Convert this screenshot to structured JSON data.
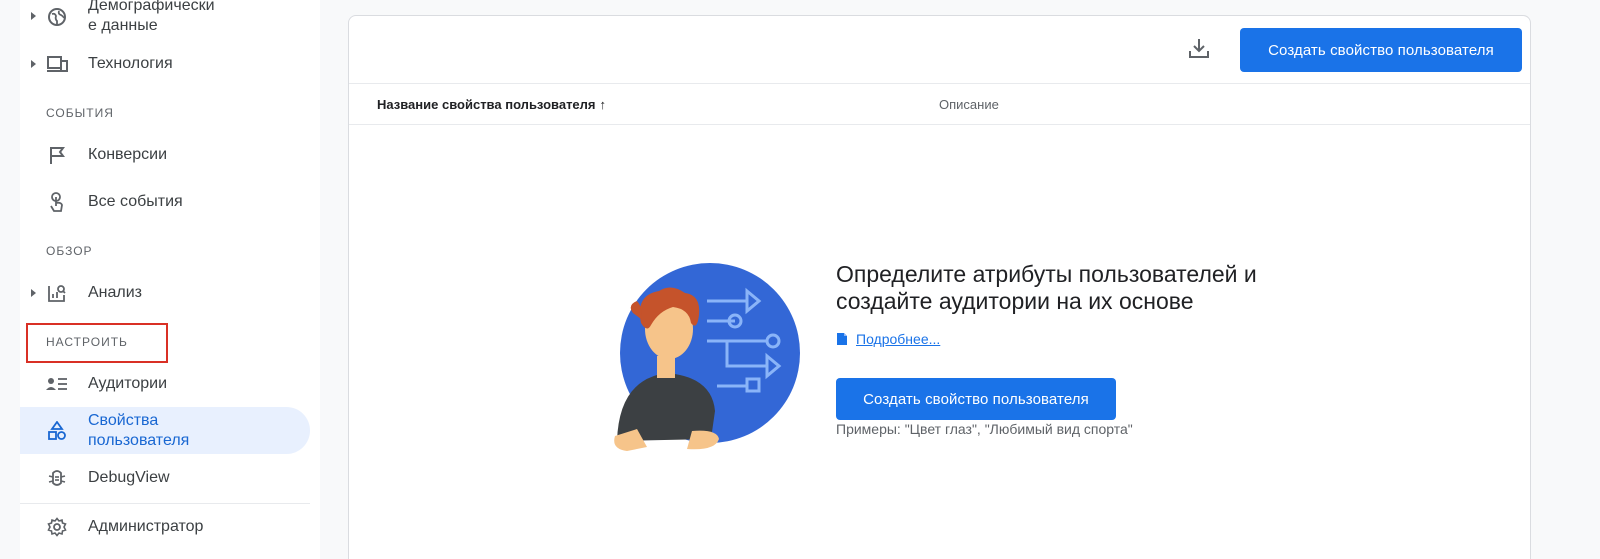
{
  "sidebar": {
    "demographics_label_line1": "Демографически",
    "demographics_label_line2": "е данные",
    "technology_label": "Технология",
    "section_events": "СОБЫТИЯ",
    "conversions_label": "Конверсии",
    "all_events_label": "Все события",
    "section_explore": "ОБЗОР",
    "analysis_label": "Анализ",
    "section_configure": "НАСТРОИТЬ",
    "audiences_label": "Аудитории",
    "user_properties_line1": "Свойства",
    "user_properties_line2": "пользователя",
    "debugview_label": "DebugView",
    "admin_label": "Администратор"
  },
  "toolbar": {
    "create_button": "Создать свойство пользователя"
  },
  "table": {
    "col_name": "Название свойства пользователя",
    "col_name_sort": "↑",
    "col_description": "Описание"
  },
  "empty_state": {
    "title_line1": "Определите атрибуты пользователей и",
    "title_line2": "создайте аудитории на их основе",
    "learn_more": "Подробнее...",
    "create_button": "Создать свойство пользователя",
    "examples": "Примеры: \"Цвет глаз\", \"Любимый вид спорта\""
  },
  "colors": {
    "accent": "#1a73e8",
    "active_bg": "#e8f0fe",
    "highlight": "#d93025"
  }
}
